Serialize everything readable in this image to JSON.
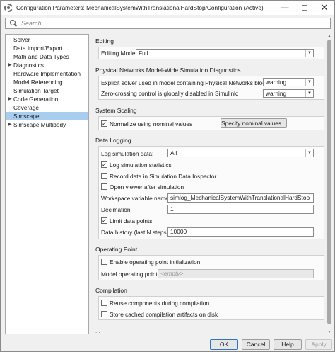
{
  "window": {
    "title": "Configuration Parameters: MechanicalSystemWithTranslationalHardStop/Configuration (Active)",
    "minimize": "—",
    "maximize": "☐",
    "close": "✕"
  },
  "search": {
    "placeholder": "Search"
  },
  "tree": {
    "items": [
      {
        "label": "Solver",
        "expandable": false,
        "selected": false
      },
      {
        "label": "Data Import/Export",
        "expandable": false,
        "selected": false
      },
      {
        "label": "Math and Data Types",
        "expandable": false,
        "selected": false
      },
      {
        "label": "Diagnostics",
        "expandable": true,
        "selected": false
      },
      {
        "label": "Hardware Implementation",
        "expandable": false,
        "selected": false
      },
      {
        "label": "Model Referencing",
        "expandable": false,
        "selected": false
      },
      {
        "label": "Simulation Target",
        "expandable": false,
        "selected": false
      },
      {
        "label": "Code Generation",
        "expandable": true,
        "selected": false
      },
      {
        "label": "Coverage",
        "expandable": false,
        "selected": false
      },
      {
        "label": "Simscape",
        "expandable": false,
        "selected": true
      },
      {
        "label": "Simscape Multibody",
        "expandable": true,
        "selected": false
      }
    ],
    "caret": "▶"
  },
  "editing": {
    "title": "Editing",
    "mode_label": "Editing Mode:",
    "mode_value": "Full"
  },
  "diagnostics": {
    "title": "Physical Networks Model-Wide Simulation Diagnostics",
    "explicit_label": "Explicit solver used in model containing Physical Networks blocks:",
    "explicit_value": "warning",
    "zero_label": "Zero-crossing control is globally disabled in Simulink:",
    "zero_value": "warning"
  },
  "scaling": {
    "title": "System Scaling",
    "normalize_label": "Normalize using nominal values",
    "normalize_checked": true,
    "nominal_button": "Specify nominal values..."
  },
  "logging": {
    "title": "Data Logging",
    "log_label": "Log simulation data:",
    "log_value": "All",
    "stats_label": "Log simulation statistics",
    "stats_checked": true,
    "record_label": "Record data in Simulation Data Inspector",
    "record_checked": false,
    "viewer_label": "Open viewer after simulation",
    "viewer_checked": false,
    "workspace_label": "Workspace variable name:",
    "workspace_value": "simlog_MechanicalSystemWithTranslationalHardStop",
    "decimation_label": "Decimation:",
    "decimation_value": "1",
    "limit_label": "Limit data points",
    "limit_checked": true,
    "history_label": "Data history (last N steps):",
    "history_value": "10000"
  },
  "operating": {
    "title": "Operating Point",
    "enable_label": "Enable operating point initialization",
    "enable_checked": false,
    "model_label": "Model operating point:",
    "model_value": "<empty>"
  },
  "compilation": {
    "title": "Compilation",
    "reuse_label": "Reuse components during compilation",
    "reuse_checked": false,
    "store_label": "Store cached compilation artifacts on disk",
    "store_checked": false
  },
  "more": "...",
  "footer": {
    "ok": "OK",
    "cancel": "Cancel",
    "help": "Help",
    "apply": "Apply"
  },
  "glyphs": {
    "check": "✓",
    "dropdown": "▼",
    "scroll_up": "▲",
    "scroll_down": "▼"
  }
}
